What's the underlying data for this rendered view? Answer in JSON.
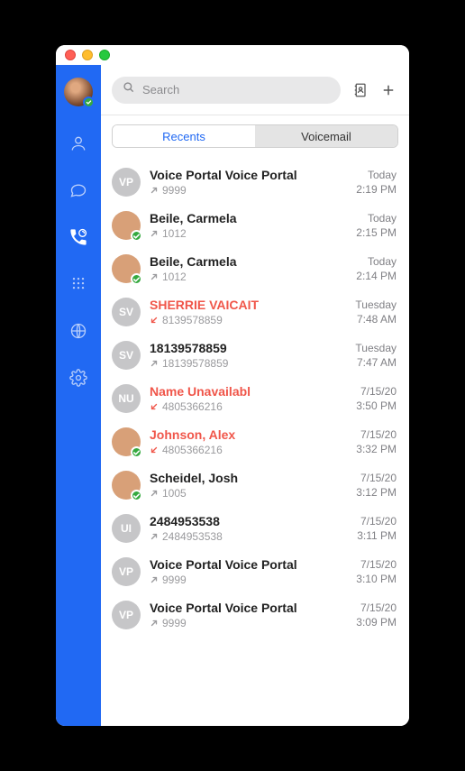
{
  "search": {
    "placeholder": "Search"
  },
  "tabs": {
    "recents": "Recents",
    "voicemail": "Voicemail",
    "active": "recents"
  },
  "calls": [
    {
      "initials": "VP",
      "name": "Voice Portal Voice Portal",
      "number": "9999",
      "direction": "out",
      "missed": false,
      "date": "Today",
      "time": "2:19 PM",
      "photo": null,
      "presence": false
    },
    {
      "initials": "",
      "name": "Beile, Carmela",
      "number": "1012",
      "direction": "out",
      "missed": false,
      "date": "Today",
      "time": "2:15 PM",
      "photo": "photo-1",
      "presence": true
    },
    {
      "initials": "",
      "name": "Beile, Carmela",
      "number": "1012",
      "direction": "out",
      "missed": false,
      "date": "Today",
      "time": "2:14 PM",
      "photo": "photo-1",
      "presence": true
    },
    {
      "initials": "SV",
      "name": "SHERRIE VAICAIT",
      "number": "8139578859",
      "direction": "in",
      "missed": true,
      "date": "Tuesday",
      "time": "7:48 AM",
      "photo": null,
      "presence": false
    },
    {
      "initials": "SV",
      "name": "18139578859",
      "number": "18139578859",
      "direction": "out",
      "missed": false,
      "date": "Tuesday",
      "time": "7:47 AM",
      "photo": null,
      "presence": false
    },
    {
      "initials": "NU",
      "name": "Name Unavailabl",
      "number": "4805366216",
      "direction": "in",
      "missed": true,
      "date": "7/15/20",
      "time": "3:50 PM",
      "photo": null,
      "presence": false
    },
    {
      "initials": "",
      "name": "Johnson, Alex",
      "number": "4805366216",
      "direction": "in",
      "missed": true,
      "date": "7/15/20",
      "time": "3:32 PM",
      "photo": "photo-2",
      "presence": true
    },
    {
      "initials": "",
      "name": "Scheidel, Josh",
      "number": "1005",
      "direction": "out",
      "missed": false,
      "date": "7/15/20",
      "time": "3:12 PM",
      "photo": "photo-2",
      "presence": true
    },
    {
      "initials": "UI",
      "name": "2484953538",
      "number": "2484953538",
      "direction": "out",
      "missed": false,
      "date": "7/15/20",
      "time": "3:11 PM",
      "photo": null,
      "presence": false
    },
    {
      "initials": "VP",
      "name": "Voice Portal Voice Portal",
      "number": "9999",
      "direction": "out",
      "missed": false,
      "date": "7/15/20",
      "time": "3:10 PM",
      "photo": null,
      "presence": false
    },
    {
      "initials": "VP",
      "name": "Voice Portal Voice Portal",
      "number": "9999",
      "direction": "out",
      "missed": false,
      "date": "7/15/20",
      "time": "3:09 PM",
      "photo": null,
      "presence": false
    }
  ]
}
